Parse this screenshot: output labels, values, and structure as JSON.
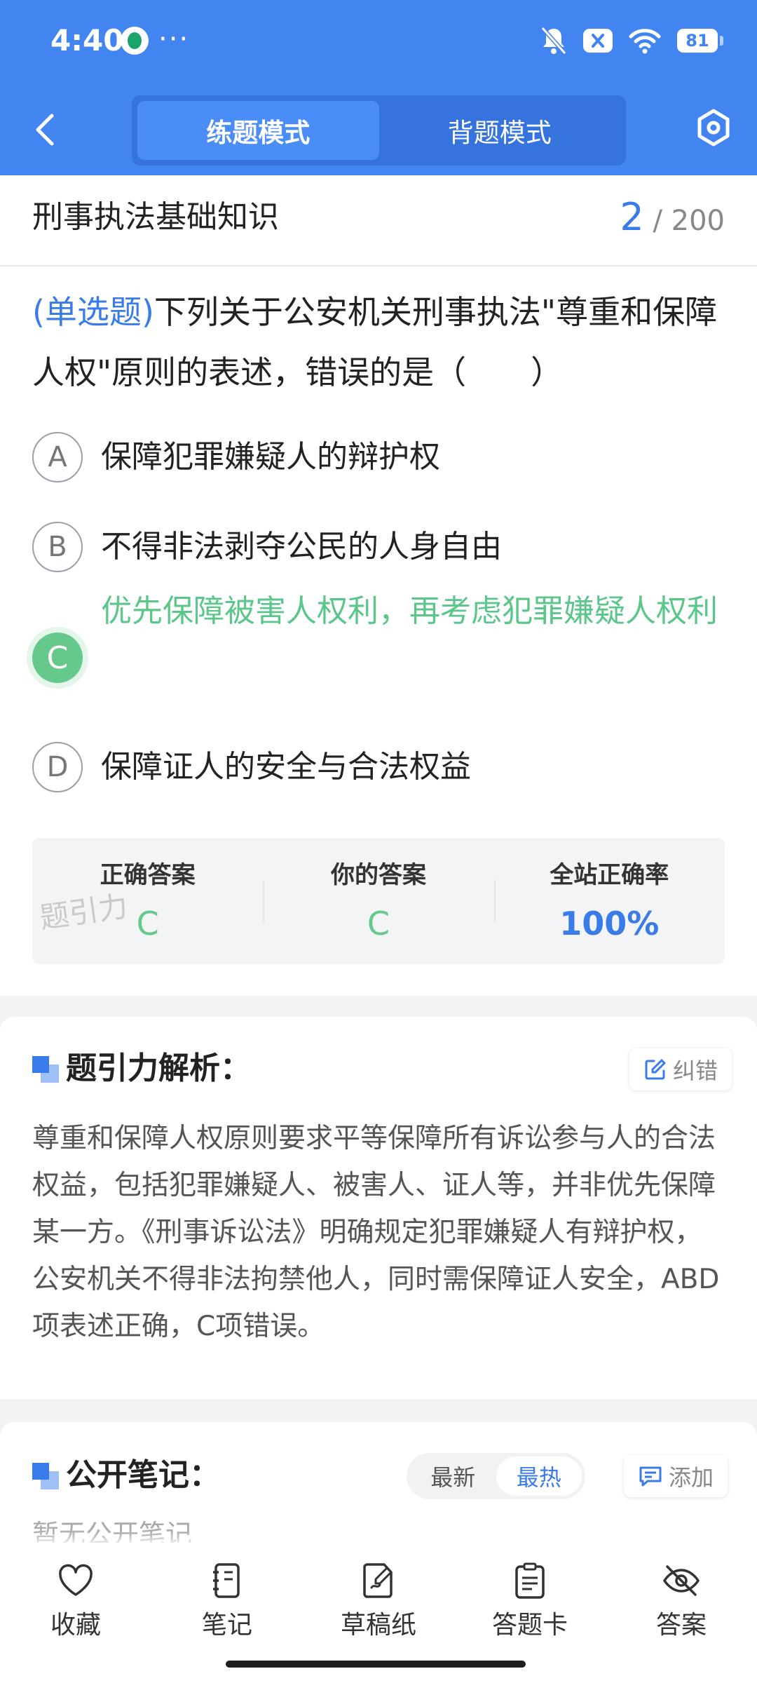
{
  "status_bar": {
    "time": "4:40",
    "dots": "···",
    "battery": "81"
  },
  "header": {
    "tabs": [
      {
        "label": "练题模式",
        "active": true
      },
      {
        "label": "背题模式",
        "active": false
      }
    ]
  },
  "question": {
    "subject": "刑事执法基础知识",
    "current": "2",
    "total": "/ 200",
    "type_label": "(单选题)",
    "text": "下列关于公安机关刑事执法\"尊重和保障人权\"原则的表述，错误的是（　　）",
    "options": [
      {
        "letter": "A",
        "text": "保障犯罪嫌疑人的辩护权"
      },
      {
        "letter": "B",
        "text": "不得非法剥夺公民的人身自由"
      },
      {
        "letter": "C",
        "text": "优先保障被害人权利，再考虑犯罪嫌疑人权利",
        "correct": true
      },
      {
        "letter": "D",
        "text": "保障证人的安全与合法权益"
      }
    ]
  },
  "result": {
    "correct_label": "正确答案",
    "correct_value": "C",
    "yours_label": "你的答案",
    "yours_value": "C",
    "rate_label": "全站正确率",
    "rate_value": "100%",
    "watermark": "题引力"
  },
  "analysis": {
    "title": "题引力解析：",
    "report_label": "纠错",
    "text": "尊重和保障人权原则要求平等保障所有诉讼参与人的合法权益，包括犯罪嫌疑人、被害人、证人等，并非优先保障某一方。《刑事诉讼法》明确规定犯罪嫌疑人有辩护权，公安机关不得非法拘禁他人，同时需保障证人安全，ABD项表述正确，C项错误。"
  },
  "notes": {
    "title": "公开笔记：",
    "sort_options": [
      {
        "label": "最新",
        "active": false
      },
      {
        "label": "最热",
        "active": true
      }
    ],
    "add_label": "添加",
    "empty_text": "暂无公开笔记"
  },
  "bottom_bar": [
    {
      "label": "收藏",
      "icon": "heart-icon"
    },
    {
      "label": "笔记",
      "icon": "notebook-icon"
    },
    {
      "label": "草稿纸",
      "icon": "draft-paper-icon"
    },
    {
      "label": "答题卡",
      "icon": "answer-card-icon"
    },
    {
      "label": "答案",
      "icon": "eye-off-icon"
    }
  ],
  "colors": {
    "primary": "#4285f0",
    "correct_green": "#64c98a",
    "accent_blue": "#3a7bea"
  }
}
